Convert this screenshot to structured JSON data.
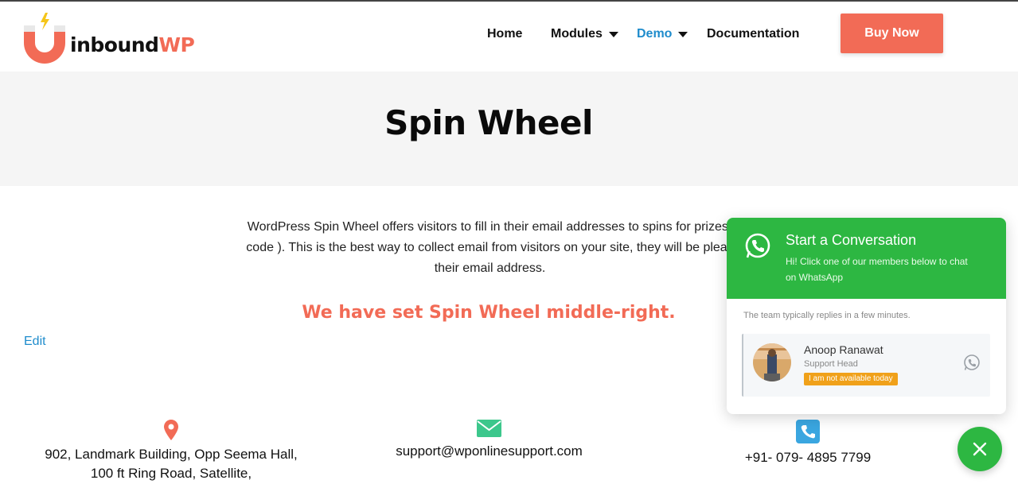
{
  "brand": {
    "logo_part1": "inbound",
    "logo_part2": "WP",
    "accent_color": "#f26b56",
    "link_color": "#1f8ccc"
  },
  "nav": {
    "home": "Home",
    "modules": "Modules",
    "demo": "Demo",
    "documentation": "Documentation",
    "buy_now": "Buy Now"
  },
  "page": {
    "title": "Spin Wheel",
    "intro_line1": "WordPress Spin Wheel offers visitors to fill in their email addresses to spins for prizes(",
    "intro_line2": "code ). This is the best way to collect email from visitors on your site, they will be pleas",
    "intro_line3": "their email address.",
    "highlight": "We have set Spin Wheel middle-right.",
    "edit_link": "Edit"
  },
  "contact": {
    "address_line1": "902, Landmark Building, Opp Seema Hall,",
    "address_line2": "100 ft Ring Road, Satellite,",
    "email": "support@wponlinesupport.com",
    "phone": "+91- 079- 4895 7799"
  },
  "whatsapp": {
    "title": "Start a Conversation",
    "subtitle": "Hi! Click one of our members below to chat on WhatsApp",
    "reply_note": "The team typically replies in a few minutes.",
    "agent_name": "Anoop Ranawat",
    "agent_role": "Support Head",
    "agent_status": "I am not available today",
    "color": "#2db742"
  },
  "icons": {
    "location": "map-pin-icon",
    "email": "envelope-icon",
    "phone": "phone-icon",
    "whatsapp": "whatsapp-icon",
    "close": "close-icon",
    "caret": "caret-down-icon"
  }
}
